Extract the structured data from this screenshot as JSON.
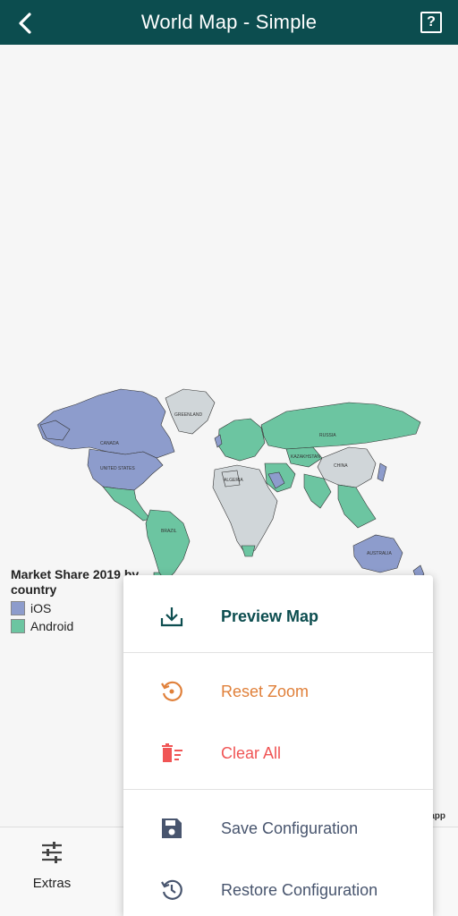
{
  "appbar": {
    "title": "World Map - Simple",
    "back_icon": "chevron-left-icon",
    "help_icon": "question-box-icon",
    "help_glyph": "?",
    "background": "#0c4d4f"
  },
  "map": {
    "country_labels": [
      "CANADA",
      "UNITED STATES",
      "GREENLAND",
      "RUSSIA",
      "CHINA",
      "BRAZIL",
      "AUSTRALIA",
      "KAZAKHSTAN",
      "ALGERIA"
    ],
    "colors": {
      "ios": "#8d9ccc",
      "android": "#6cc5a1",
      "nodata": "#d0d6d9"
    }
  },
  "legend": {
    "title": "Market Share 2019 by country",
    "items": [
      {
        "label": "iOS",
        "color": "#8d9ccc"
      },
      {
        "label": "Android",
        "color": "#6cc5a1"
      }
    ]
  },
  "watermark": "app",
  "bottombar": {
    "extras": {
      "label": "Extras",
      "icon": "sliders-icon"
    }
  },
  "menu": {
    "items": [
      {
        "label": "Preview Map",
        "icon": "download-icon",
        "color": "#0c4d4f"
      },
      {
        "label": "Reset Zoom",
        "icon": "reset-zoom-icon",
        "color": "#e0803a"
      },
      {
        "label": "Clear All",
        "icon": "trash-list-icon",
        "color": "#f05555"
      },
      {
        "label": "Save Configuration",
        "icon": "floppy-disk-icon",
        "color": "#48556e"
      },
      {
        "label": "Restore Configuration",
        "icon": "history-icon",
        "color": "#48556e"
      }
    ]
  }
}
